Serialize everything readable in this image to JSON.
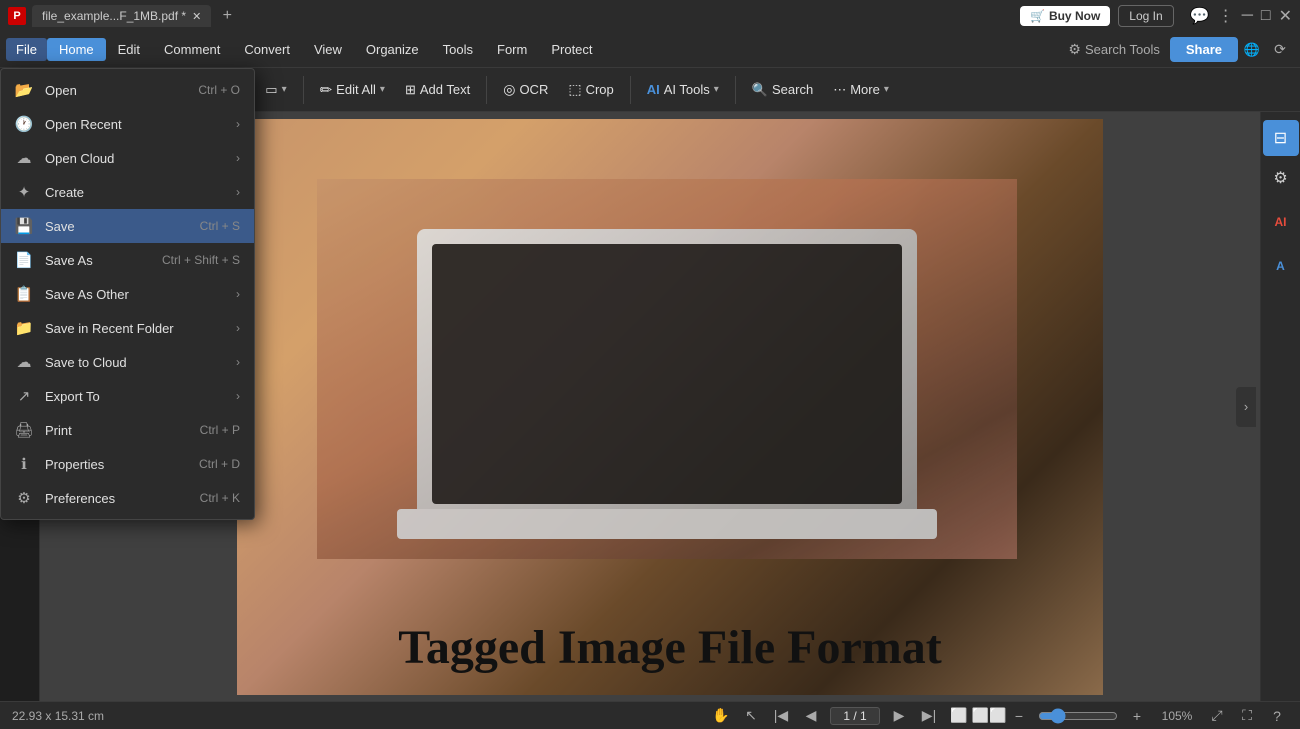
{
  "titlebar": {
    "tab_label": "file_example...F_1MB.pdf *",
    "buy_now": "Buy Now",
    "log_in": "Log In"
  },
  "menubar": {
    "items": [
      "File",
      "Home",
      "Edit",
      "Comment",
      "Convert",
      "View",
      "Organize",
      "Tools",
      "Form",
      "Protect"
    ],
    "active": "Home",
    "search_tools": "Search Tools",
    "share": "Share"
  },
  "toolbar": {
    "zoom_in": "🔍",
    "highlight": "✏️",
    "edit_all": "Edit All",
    "add_text": "Add Text",
    "ocr": "OCR",
    "crop": "Crop",
    "ai_tools": "AI Tools",
    "search": "Search",
    "more": "More"
  },
  "file_menu": {
    "items": [
      {
        "id": "open",
        "label": "Open",
        "shortcut": "Ctrl + O",
        "has_arrow": false
      },
      {
        "id": "open-recent",
        "label": "Open Recent",
        "shortcut": "",
        "has_arrow": true
      },
      {
        "id": "open-cloud",
        "label": "Open Cloud",
        "shortcut": "",
        "has_arrow": true
      },
      {
        "id": "create",
        "label": "Create",
        "shortcut": "",
        "has_arrow": true
      },
      {
        "id": "save",
        "label": "Save",
        "shortcut": "Ctrl + S",
        "has_arrow": false,
        "highlighted": true
      },
      {
        "id": "save-as",
        "label": "Save As",
        "shortcut": "Ctrl + Shift + S",
        "has_arrow": false
      },
      {
        "id": "save-as-other",
        "label": "Save As Other",
        "shortcut": "",
        "has_arrow": true
      },
      {
        "id": "save-in-recent-folder",
        "label": "Save in Recent Folder",
        "shortcut": "",
        "has_arrow": true
      },
      {
        "id": "save-to-cloud",
        "label": "Save to Cloud",
        "shortcut": "",
        "has_arrow": true
      },
      {
        "id": "export-to",
        "label": "Export To",
        "shortcut": "",
        "has_arrow": true
      },
      {
        "id": "print",
        "label": "Print",
        "shortcut": "Ctrl + P",
        "has_arrow": false
      },
      {
        "id": "properties",
        "label": "Properties",
        "shortcut": "Ctrl + D",
        "has_arrow": false
      },
      {
        "id": "preferences",
        "label": "Preferences",
        "shortcut": "Ctrl + K",
        "has_arrow": false
      }
    ]
  },
  "pdf_content": {
    "text": "Tagged Image File Format"
  },
  "statusbar": {
    "dimensions": "22.93 x 15.31 cm",
    "page_display": "1 / 1",
    "zoom": "105%"
  }
}
